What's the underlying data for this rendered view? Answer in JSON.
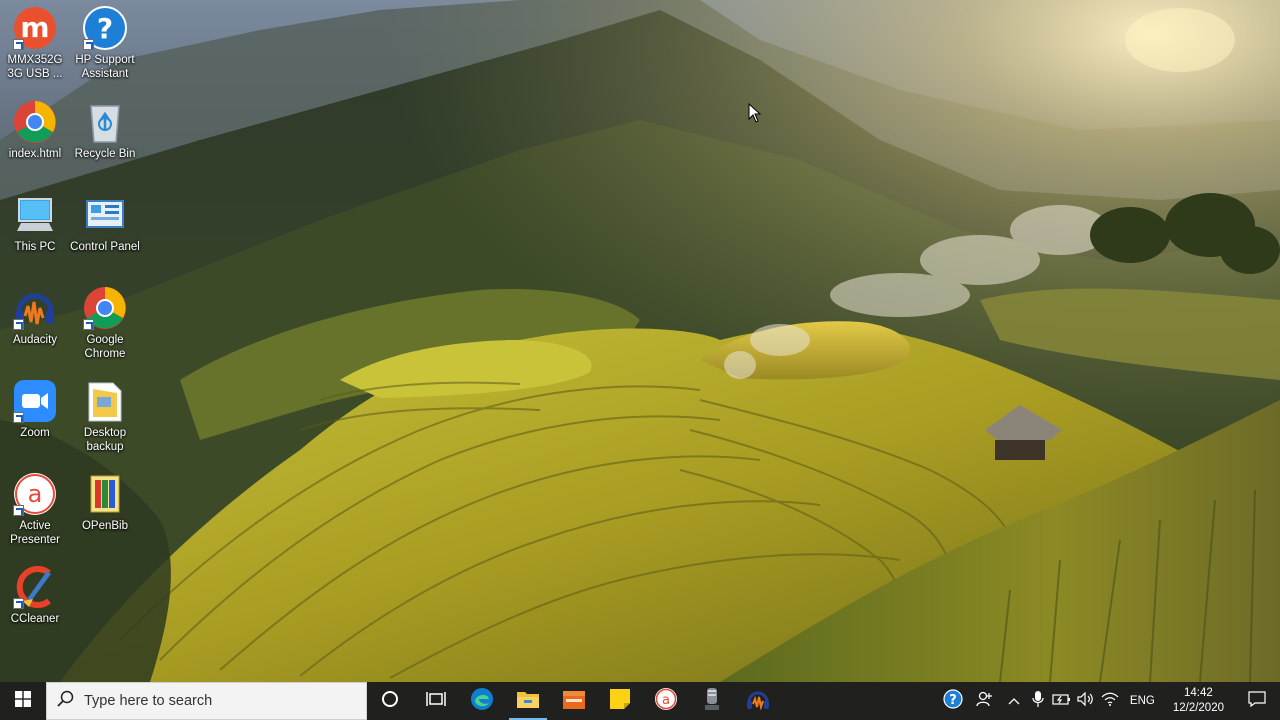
{
  "desktop": {
    "icons": [
      {
        "label": "MMX352G 3G USB ...",
        "icon": "mmx-modem-icon"
      },
      {
        "label": "HP Support Assistant",
        "icon": "hp-support-icon"
      },
      {
        "label": "index.html",
        "icon": "chrome-html-icon"
      },
      {
        "label": "Recycle Bin",
        "icon": "recycle-bin-icon"
      },
      {
        "label": "This PC",
        "icon": "this-pc-icon"
      },
      {
        "label": "Control Panel",
        "icon": "control-panel-icon"
      },
      {
        "label": "Audacity",
        "icon": "audacity-icon"
      },
      {
        "label": "Google Chrome",
        "icon": "chrome-icon"
      },
      {
        "label": "Zoom",
        "icon": "zoom-icon"
      },
      {
        "label": "Desktop backup",
        "icon": "folder-icon"
      },
      {
        "label": "Active Presenter",
        "icon": "active-presenter-icon"
      },
      {
        "label": "OPenBib",
        "icon": "openbib-icon"
      },
      {
        "label": "CCleaner",
        "icon": "ccleaner-icon"
      }
    ]
  },
  "taskbar": {
    "search_placeholder": "Type here to search",
    "pinned": [
      "cortana-icon",
      "task-view-icon",
      "edge-icon",
      "file-explorer-icon",
      "store-app-icon",
      "sticky-notes-icon",
      "active-presenter-icon",
      "microphone-app-icon",
      "audacity-icon"
    ],
    "tray": {
      "language": "ENG",
      "time": "14:42",
      "date": "12/2/2020"
    }
  },
  "colors": {
    "taskbar_bg": "#20211f",
    "search_bg": "#f3f3f3",
    "accent": "#76b9ed"
  }
}
